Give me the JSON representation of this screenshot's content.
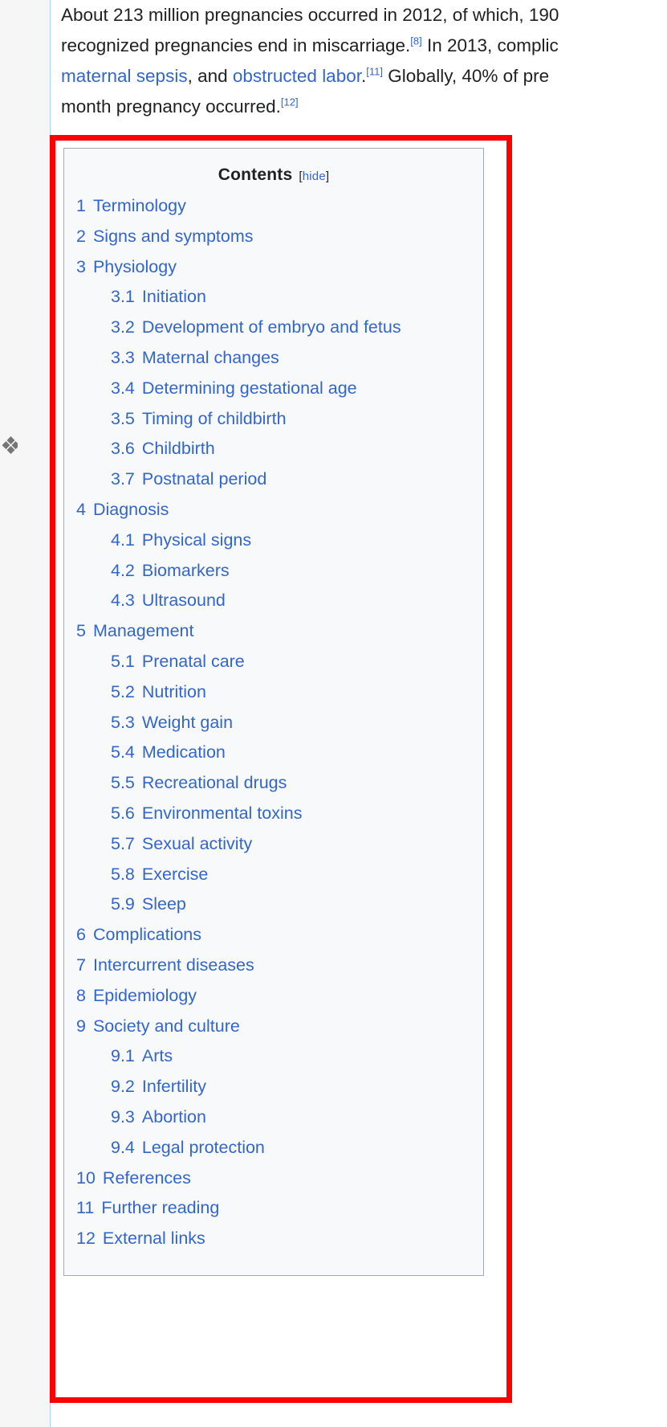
{
  "article": {
    "lead_lines": [
      {
        "segments": [
          {
            "type": "text",
            "value": "About 213 million pregnancies occurred in 2012, of which, 190"
          }
        ]
      },
      {
        "segments": [
          {
            "type": "text",
            "value": "recognized pregnancies end in miscarriage."
          },
          {
            "type": "ref",
            "value": "[8]"
          },
          {
            "type": "text",
            "value": " In 2013, complic"
          }
        ]
      },
      {
        "segments": [
          {
            "type": "link",
            "value": "maternal sepsis"
          },
          {
            "type": "text",
            "value": ", and "
          },
          {
            "type": "link",
            "value": "obstructed labor"
          },
          {
            "type": "text",
            "value": "."
          },
          {
            "type": "ref",
            "value": "[11]"
          },
          {
            "type": "text",
            "value": " Globally, 40% of pre"
          }
        ]
      },
      {
        "segments": [
          {
            "type": "text",
            "value": "month pregnancy occurred."
          },
          {
            "type": "ref",
            "value": "[12]"
          }
        ]
      }
    ]
  },
  "toc": {
    "title": "Contents",
    "toggle_open_bracket": "[",
    "toggle_label": "hide",
    "toggle_close_bracket": "]",
    "items": [
      {
        "level": 1,
        "number": "1",
        "label": "Terminology"
      },
      {
        "level": 1,
        "number": "2",
        "label": "Signs and symptoms"
      },
      {
        "level": 1,
        "number": "3",
        "label": "Physiology"
      },
      {
        "level": 2,
        "number": "3.1",
        "label": "Initiation"
      },
      {
        "level": 2,
        "number": "3.2",
        "label": "Development of embryo and fetus"
      },
      {
        "level": 2,
        "number": "3.3",
        "label": "Maternal changes"
      },
      {
        "level": 2,
        "number": "3.4",
        "label": "Determining gestational age"
      },
      {
        "level": 2,
        "number": "3.5",
        "label": "Timing of childbirth"
      },
      {
        "level": 2,
        "number": "3.6",
        "label": "Childbirth"
      },
      {
        "level": 2,
        "number": "3.7",
        "label": "Postnatal period"
      },
      {
        "level": 1,
        "number": "4",
        "label": "Diagnosis"
      },
      {
        "level": 2,
        "number": "4.1",
        "label": "Physical signs"
      },
      {
        "level": 2,
        "number": "4.2",
        "label": "Biomarkers"
      },
      {
        "level": 2,
        "number": "4.3",
        "label": "Ultrasound"
      },
      {
        "level": 1,
        "number": "5",
        "label": "Management"
      },
      {
        "level": 2,
        "number": "5.1",
        "label": "Prenatal care"
      },
      {
        "level": 2,
        "number": "5.2",
        "label": "Nutrition"
      },
      {
        "level": 2,
        "number": "5.3",
        "label": "Weight gain"
      },
      {
        "level": 2,
        "number": "5.4",
        "label": "Medication"
      },
      {
        "level": 2,
        "number": "5.5",
        "label": "Recreational drugs"
      },
      {
        "level": 2,
        "number": "5.6",
        "label": "Environmental toxins"
      },
      {
        "level": 2,
        "number": "5.7",
        "label": "Sexual activity"
      },
      {
        "level": 2,
        "number": "5.8",
        "label": "Exercise"
      },
      {
        "level": 2,
        "number": "5.9",
        "label": "Sleep"
      },
      {
        "level": 1,
        "number": "6",
        "label": "Complications"
      },
      {
        "level": 1,
        "number": "7",
        "label": "Intercurrent diseases"
      },
      {
        "level": 1,
        "number": "8",
        "label": "Epidemiology"
      },
      {
        "level": 1,
        "number": "9",
        "label": "Society and culture"
      },
      {
        "level": 2,
        "number": "9.1",
        "label": "Arts"
      },
      {
        "level": 2,
        "number": "9.2",
        "label": "Infertility"
      },
      {
        "level": 2,
        "number": "9.3",
        "label": "Abortion"
      },
      {
        "level": 2,
        "number": "9.4",
        "label": "Legal protection"
      },
      {
        "level": 1,
        "number": "10",
        "label": "References"
      },
      {
        "level": 1,
        "number": "11",
        "label": "Further reading"
      },
      {
        "level": 1,
        "number": "12",
        "label": "External links"
      }
    ]
  },
  "annotation": {
    "shape": "rectangle",
    "color": "#ff0000",
    "stroke_width": 7
  },
  "colors": {
    "link": "#3366cc",
    "text": "#202122",
    "toc_background": "#f8f9fa",
    "toc_border": "#a2a9b1",
    "content_rule": "#a7d7f9",
    "gutter_background": "#f6f6f6",
    "annotation": "#ff0000"
  },
  "gutter": {
    "glyph": "❖"
  }
}
